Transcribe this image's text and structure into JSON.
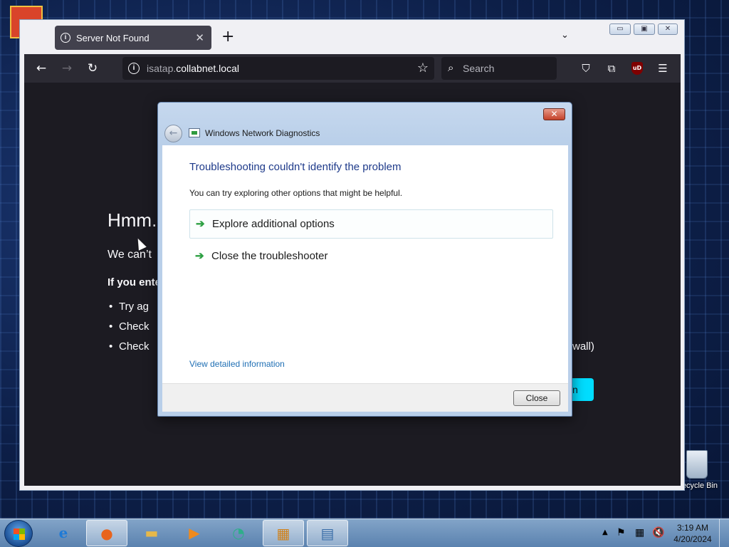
{
  "desktop": {
    "recycle_bin_label": "Recycle Bin"
  },
  "browser": {
    "tab_title": "Server Not Found",
    "tab_close": "✕",
    "new_tab": "+",
    "tab_list": "⌄",
    "url_subdomain": "isatap.",
    "url_domain": "collabnet.local",
    "search_placeholder": "Search",
    "window_controls": [
      "▭",
      "▣",
      "✕"
    ]
  },
  "page": {
    "heading": "Hmm.",
    "line1": "We can’t",
    "line2": "If you ente",
    "bullets": [
      "Try ag",
      "Check",
      "Check"
    ],
    "tail_text": "wall)",
    "button_fragment": "n"
  },
  "dialog": {
    "title": "Windows Network Diagnostics",
    "heading": "Troubleshooting couldn't identify the problem",
    "subtext": "You can try exploring other options that might be helpful.",
    "options": [
      {
        "label": "Explore additional options"
      },
      {
        "label": "Close the troubleshooter"
      }
    ],
    "detail_link": "View detailed information",
    "close_button": "Close"
  },
  "taskbar": {
    "apps": [
      {
        "name": "internet-explorer",
        "glyph": "e"
      },
      {
        "name": "firefox",
        "glyph": "●"
      },
      {
        "name": "file-explorer",
        "glyph": "▬"
      },
      {
        "name": "media-player",
        "glyph": "▶"
      },
      {
        "name": "app-circle",
        "glyph": "◔"
      },
      {
        "name": "control-panel",
        "glyph": "▦"
      },
      {
        "name": "network-diagnostics",
        "glyph": "▤"
      }
    ],
    "time": "3:19 AM",
    "date": "4/20/2024"
  },
  "colors": {
    "accent": "#00ddff",
    "dialog_heading": "#1e3a8a",
    "link": "#1f6fb4",
    "arrow": "#2ea043"
  }
}
